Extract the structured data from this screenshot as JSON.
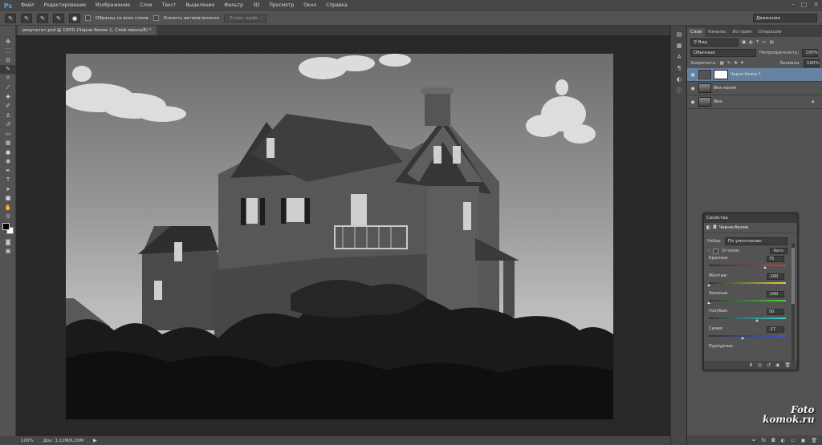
{
  "app": {
    "logo": "Ps"
  },
  "menu": [
    "Файл",
    "Редактирование",
    "Изображение",
    "Слои",
    "Текст",
    "Выделение",
    "Фильтр",
    "3D",
    "Просмотр",
    "Окно",
    "Справка"
  ],
  "options": {
    "sample_all_layers": "Образец со всех слоев",
    "auto_enhance": "Усилить автоматически",
    "refine_edge": "Уточн. край...",
    "workspace": "Движение"
  },
  "document": {
    "tab_title": "результат.psd @ 100% (Черно-белое 1, Слой-маска/8) *"
  },
  "status": {
    "zoom": "100%",
    "doc_size": "Док: 3,12M/6,29M"
  },
  "layers_panel": {
    "tabs": [
      "Слои",
      "Каналы",
      "История",
      "Операции"
    ],
    "kind_filter": "Вид",
    "blend_mode": "Обычные",
    "opacity_label": "Непрозрачность:",
    "opacity_value": "100%",
    "lock_label": "Закрепить:",
    "fill_label": "Заливка:",
    "fill_value": "100%",
    "layers": [
      {
        "name": "Черно-белое 1",
        "selected": true
      },
      {
        "name": "Фон копия",
        "selected": false
      },
      {
        "name": "Фон",
        "selected": false,
        "locked": true
      }
    ]
  },
  "properties": {
    "title": "Свойства",
    "header": "Черно-белое",
    "preset_label": "Набор:",
    "preset_value": "По умолчанию",
    "tint_label": "Оттенок",
    "auto_button": "Авто",
    "channels": [
      {
        "label": "Красные:",
        "value": "75",
        "pos": 0.73
      },
      {
        "label": "Желтые:",
        "value": "-200",
        "pos": 0.0
      },
      {
        "label": "Зеленые:",
        "value": "-200",
        "pos": 0.0
      },
      {
        "label": "Голубые:",
        "value": "50",
        "pos": 0.63
      },
      {
        "label": "Синие:",
        "value": "-17",
        "pos": 0.44
      }
    ],
    "next_channel_partial": "Пурпурные:"
  },
  "watermark": {
    "line1": "Foto",
    "line2": "komok.ru"
  },
  "icons": {
    "tools": [
      "move-icon",
      "marquee-icon",
      "lasso-icon",
      "quick-select-icon",
      "crop-icon",
      "eyedropper-icon",
      "healing-icon",
      "brush-icon",
      "clone-stamp-icon",
      "history-brush-icon",
      "eraser-icon",
      "gradient-icon",
      "blur-icon",
      "dodge-icon",
      "pen-icon",
      "type-icon",
      "path-select-icon",
      "shape-icon",
      "hand-icon",
      "zoom-icon"
    ]
  }
}
